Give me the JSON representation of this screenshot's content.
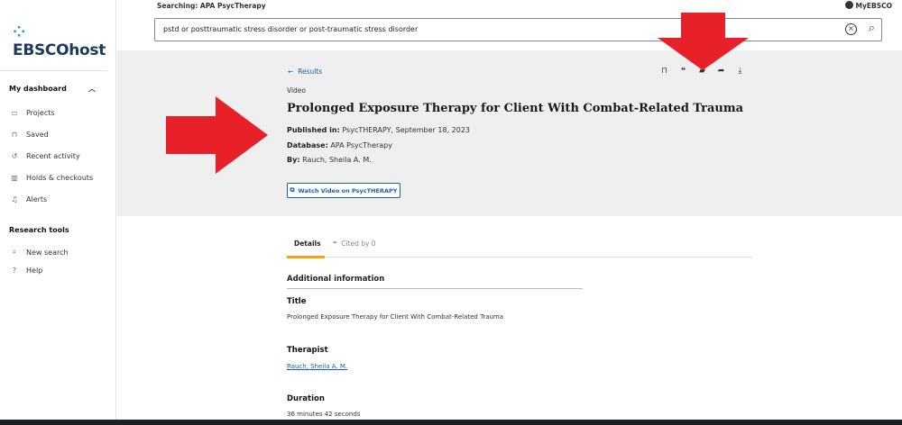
{
  "app": {
    "logo": "EBSCOhost",
    "searching_label": "Searching: APA PsycTherapy",
    "account_label": "MyEBSCO"
  },
  "search": {
    "query": "pstd or posttraumatic stress disorder or post-traumatic stress disorder"
  },
  "sidebar": {
    "dashboard_heading": "My dashboard",
    "dashboard_items": [
      {
        "label": "Projects",
        "icon": "folder-icon"
      },
      {
        "label": "Saved",
        "icon": "bookmark-icon"
      },
      {
        "label": "Recent activity",
        "icon": "history-icon"
      },
      {
        "label": "Holds & checkouts",
        "icon": "books-icon"
      },
      {
        "label": "Alerts",
        "icon": "bell-icon"
      }
    ],
    "tools_heading": "Research tools",
    "tools_items": [
      {
        "label": "New search",
        "icon": "search-icon"
      },
      {
        "label": "Help",
        "icon": "help-icon"
      }
    ]
  },
  "record": {
    "back_label": "Results",
    "type": "Video",
    "title": "Prolonged Exposure Therapy for Client With Combat-Related Trauma",
    "published_label": "Published in:",
    "published_value": "PsycTHERAPY, September 18, 2023",
    "database_label": "Database:",
    "database_value": "APA PsycTherapy",
    "by_label": "By:",
    "by_value": "Rauch, Sheila A. M.",
    "watch_button": "Watch Video on PsycTHERAPY",
    "toolbar_icons": [
      "bookmark-icon",
      "cite-icon",
      "add-to-folder-icon",
      "share-icon",
      "download-icon"
    ]
  },
  "details": {
    "tab_details": "Details",
    "tab_cited": "Cited by 0",
    "section_heading": "Additional information",
    "fields": [
      {
        "label": "Title",
        "value": "Prolonged Exposure Therapy for Client With Combat-Related Trauma"
      },
      {
        "label": "Therapist",
        "value": "Rauch, Sheila A. M."
      },
      {
        "label": "Duration",
        "value": "36 minutes 42 seconds"
      }
    ]
  },
  "colors": {
    "accent_link": "#1a5fb4",
    "tab_underline": "#f2a31b",
    "arrow": "#e8202a",
    "band_bg": "#efefef"
  }
}
